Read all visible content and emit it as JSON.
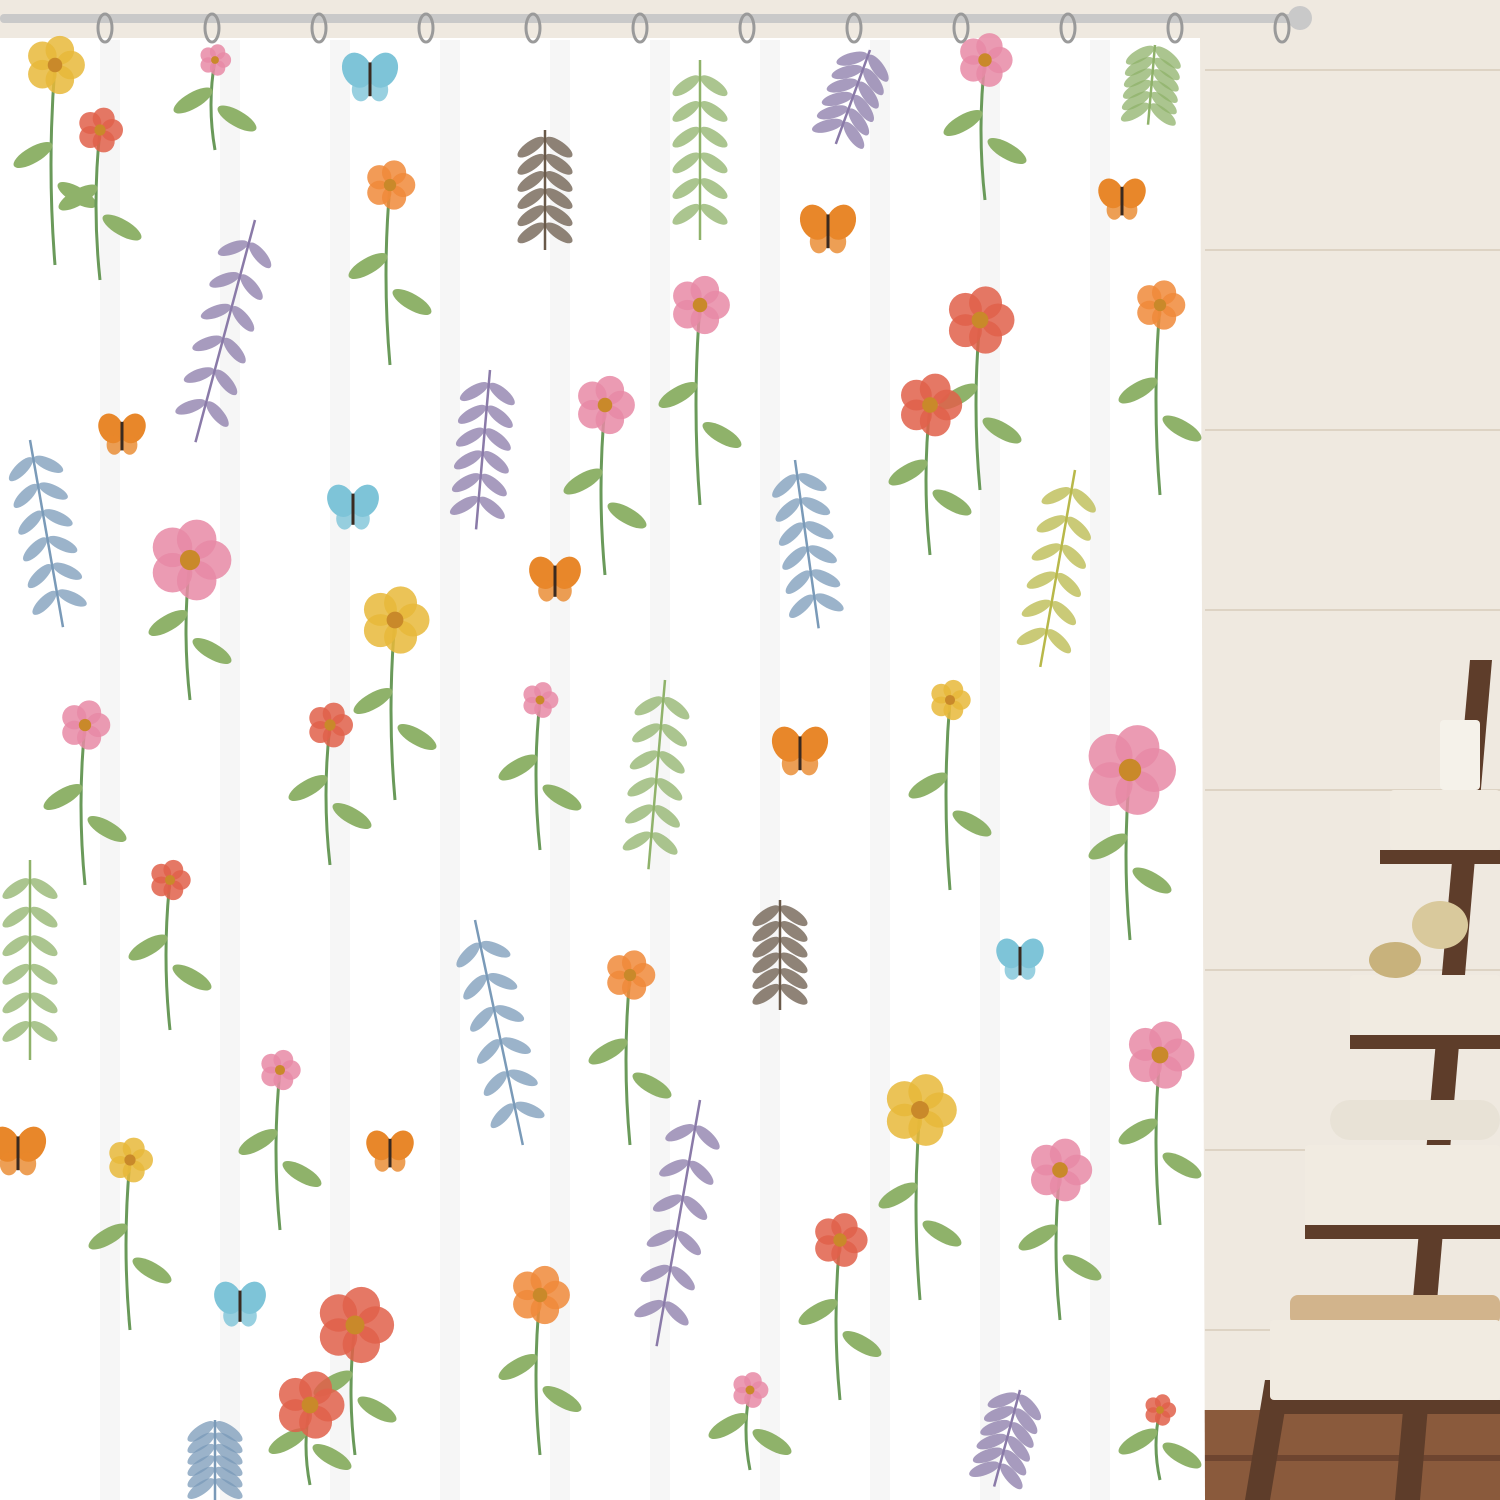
{
  "scene": {
    "subject": "floral-shower-curtain",
    "hook_count": 12,
    "palette": {
      "wall": "#efe9e0",
      "wall_shadow": "#e2dace",
      "floor": "#8a5a3c",
      "floor_dark": "#6e4530",
      "curtain": "#ffffff",
      "curtain_fold": "#eeeeee",
      "rod": "#c9c9c9",
      "ladder_wood": "#5e3d2a",
      "basket": "#f1ebe1",
      "towel": "#e8e2d6",
      "stem": "#6a9a5a",
      "leaf_green": "#8fb26a",
      "leaf_purple": "#8a7aa8",
      "leaf_blue": "#7a9ab8",
      "flower_pink": "#e78aa6",
      "flower_coral": "#e0604a",
      "flower_orange": "#f08a3a",
      "flower_yellow": "#e8b83a",
      "butterfly_blue": "#7ec4d8",
      "butterfly_orange": "#e8872a"
    }
  }
}
